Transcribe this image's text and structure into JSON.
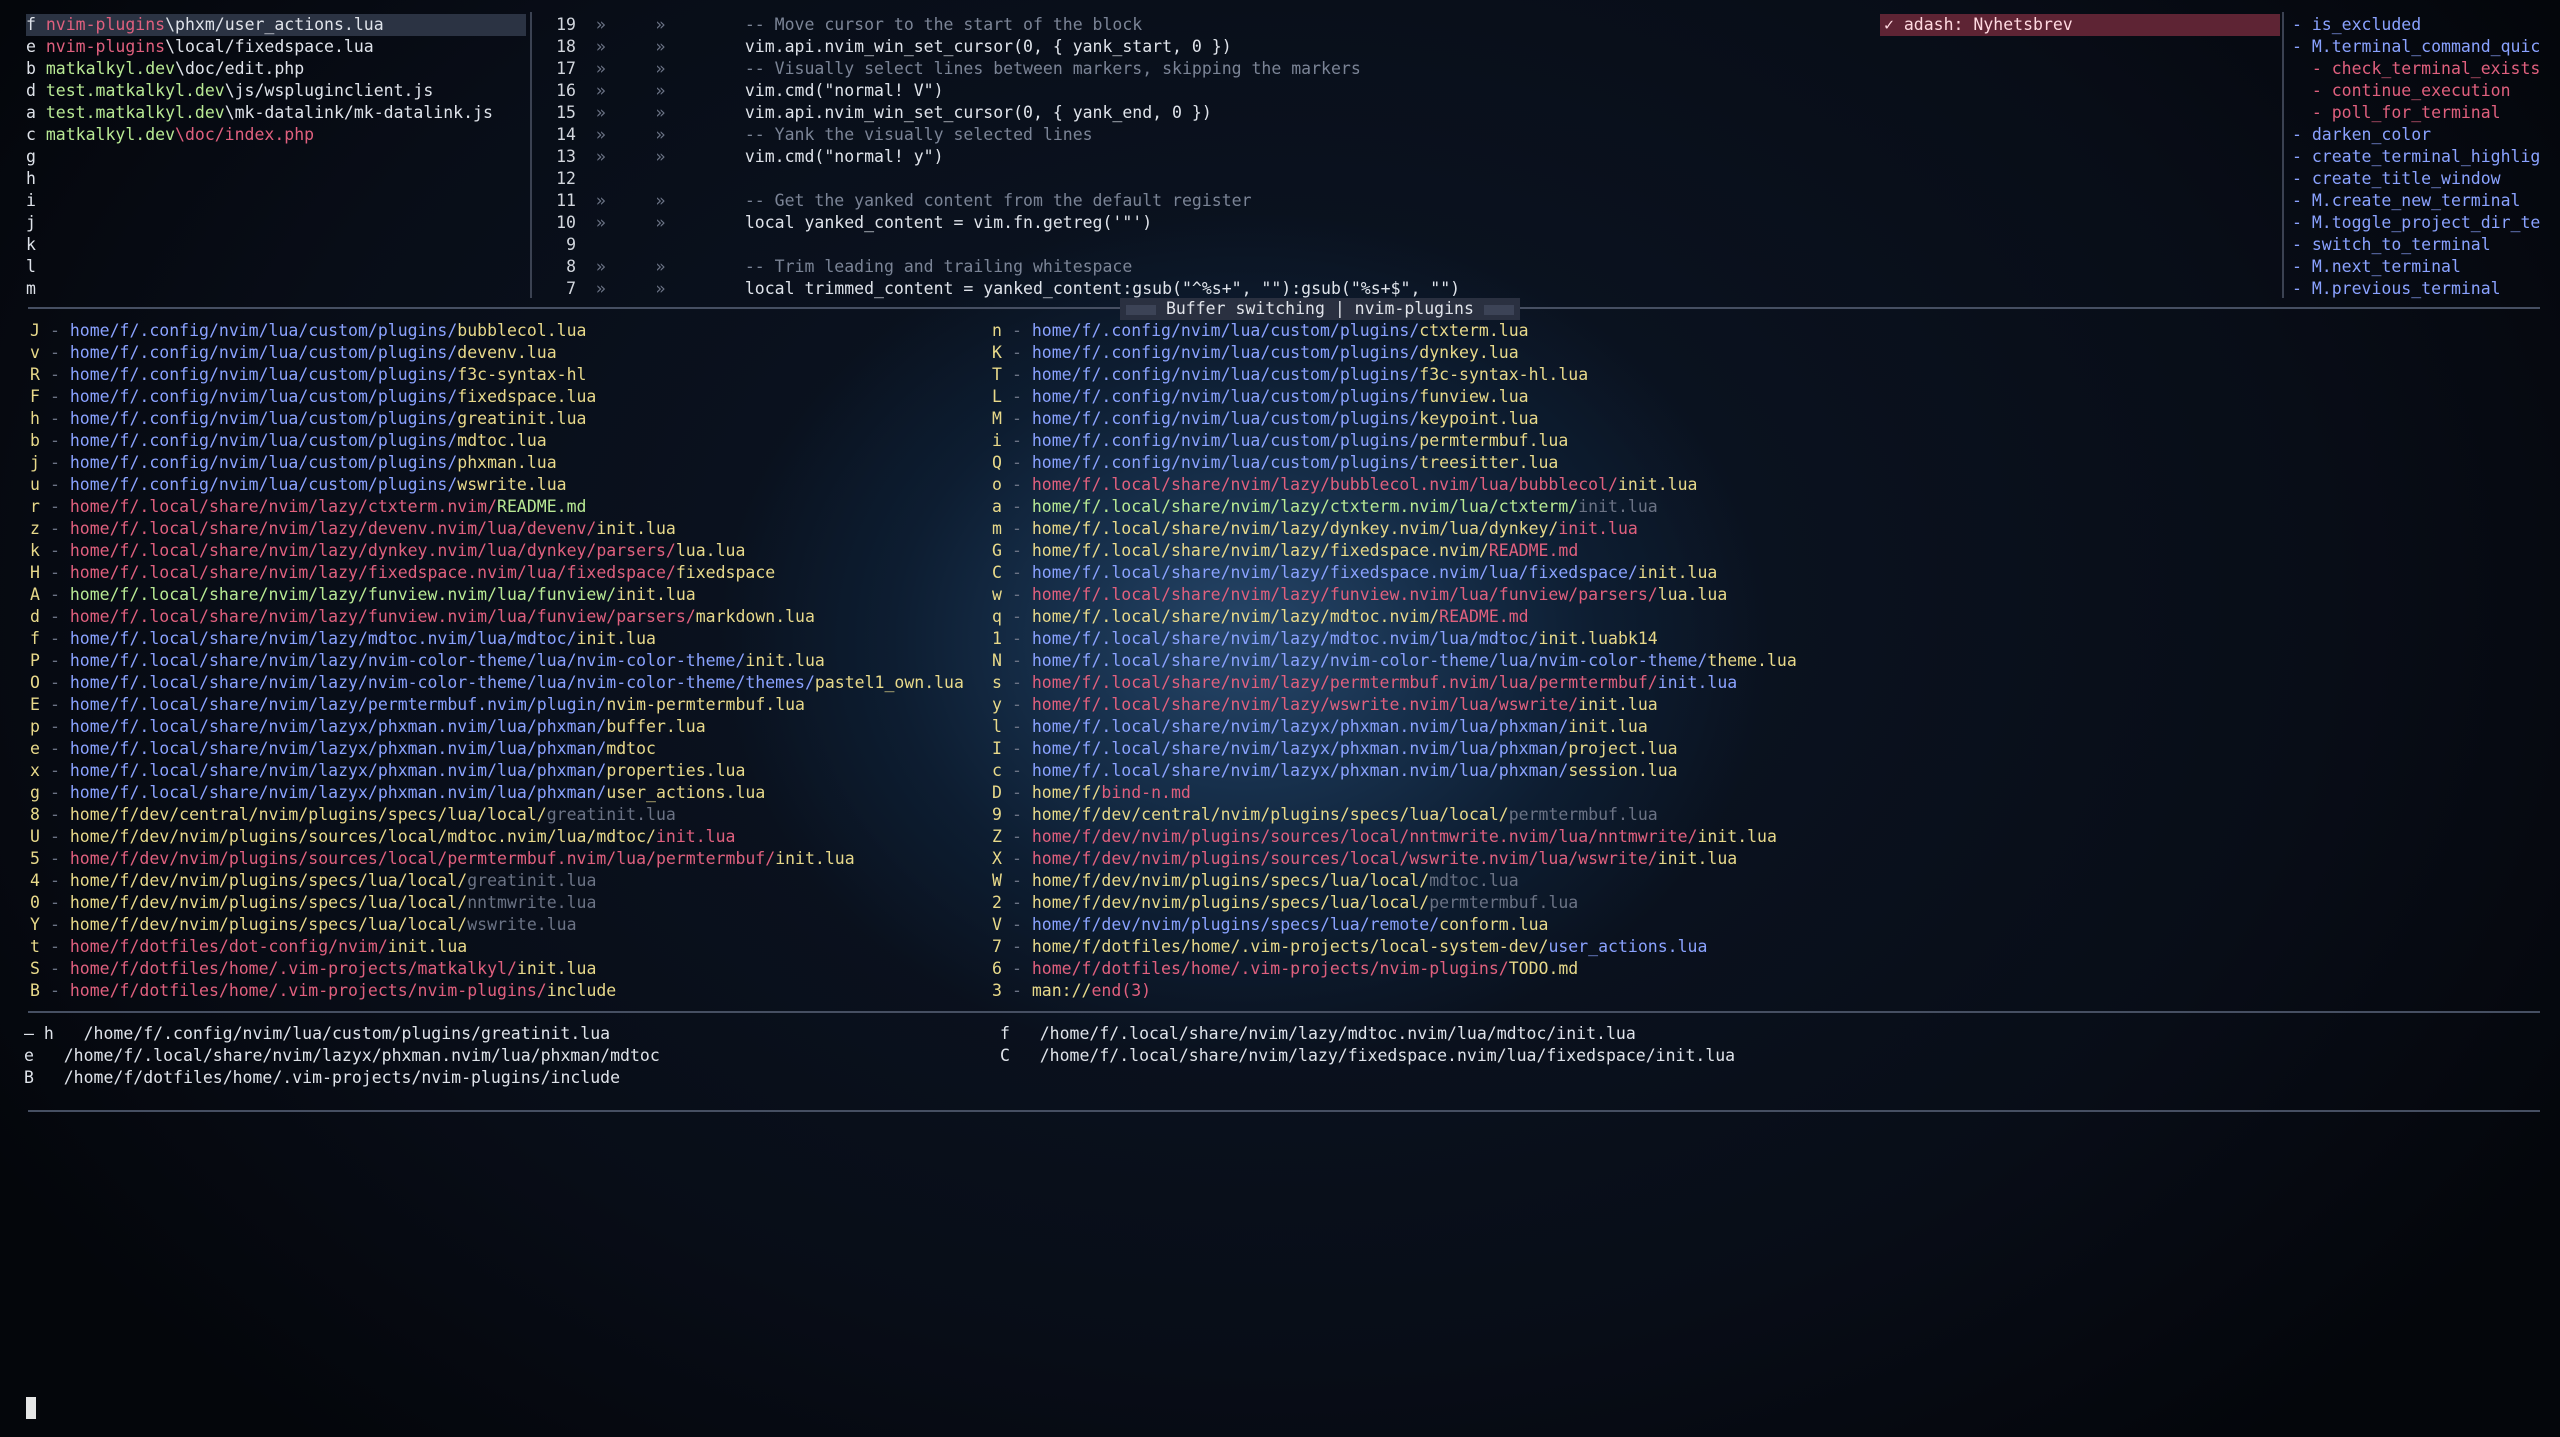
{
  "quick_list": [
    {
      "key": "f",
      "parts": [
        {
          "t": "nvim-plugins",
          "c": "red"
        },
        {
          "t": "\\phxm/user_actions.lua",
          "c": "white"
        }
      ],
      "selected": true
    },
    {
      "key": "e",
      "parts": [
        {
          "t": "nvim-plugins",
          "c": "red"
        },
        {
          "t": "\\local/fixedspace.lua",
          "c": "white"
        }
      ]
    },
    {
      "key": "b",
      "parts": [
        {
          "t": "matkalkyl.dev",
          "c": "green"
        },
        {
          "t": "\\doc/edit.php",
          "c": "white"
        }
      ]
    },
    {
      "key": "d",
      "parts": [
        {
          "t": "test.matkalkyl.dev",
          "c": "green"
        },
        {
          "t": "\\js/wspluginclient.js",
          "c": "white"
        }
      ]
    },
    {
      "key": "a",
      "parts": [
        {
          "t": "test.matkalkyl.dev",
          "c": "green"
        },
        {
          "t": "\\mk-datalink/mk-datalink.js",
          "c": "white"
        }
      ]
    },
    {
      "key": "c",
      "parts": [
        {
          "t": "matkalkyl.dev",
          "c": "green"
        },
        {
          "t": "\\doc/index.php",
          "c": "red"
        }
      ]
    },
    {
      "key": "g",
      "parts": []
    },
    {
      "key": "h",
      "parts": []
    },
    {
      "key": "i",
      "parts": []
    },
    {
      "key": "j",
      "parts": []
    },
    {
      "key": "k",
      "parts": []
    },
    {
      "key": "l",
      "parts": []
    },
    {
      "key": "m",
      "parts": []
    }
  ],
  "code_lines": [
    {
      "n": "19",
      "a": "»     »",
      "t": "  -- Move cursor to the start of the block",
      "c": "comment"
    },
    {
      "n": "18",
      "a": "»     »",
      "t": "  vim.api.nvim_win_set_cursor(0, { yank_start, 0 })",
      "c": "white"
    },
    {
      "n": "17",
      "a": "»     »",
      "t": "  -- Visually select lines between markers, skipping the markers",
      "c": "comment"
    },
    {
      "n": "16",
      "a": "»     »",
      "t": "  vim.cmd(\"normal! V\")",
      "c": "white"
    },
    {
      "n": "15",
      "a": "»     »",
      "t": "  vim.api.nvim_win_set_cursor(0, { yank_end, 0 })",
      "c": "white"
    },
    {
      "n": "14",
      "a": "»     »",
      "t": "  -- Yank the visually selected lines",
      "c": "comment"
    },
    {
      "n": "13",
      "a": "»     »",
      "t": "  vim.cmd(\"normal! y\")",
      "c": "white"
    },
    {
      "n": "12",
      "a": "",
      "t": "",
      "c": "white"
    },
    {
      "n": "11",
      "a": "»     »",
      "t": "  -- Get the yanked content from the default register",
      "c": "comment"
    },
    {
      "n": "10",
      "a": "»     »",
      "t": "  local yanked_content = vim.fn.getreg('\"')",
      "c": "white"
    },
    {
      "n": "9",
      "a": "",
      "t": "",
      "c": "white"
    },
    {
      "n": "8",
      "a": "»     »",
      "t": "  -- Trim leading and trailing whitespace",
      "c": "comment"
    },
    {
      "n": "7",
      "a": "»     »",
      "t": "  local trimmed_content = yanked_content:gsub(\"^%s+\", \"\"):gsub(\"%s+$\", \"\")",
      "c": "white"
    }
  ],
  "notification": "✓ adash: Nyhetsbrev",
  "outline": [
    {
      "t": "- is_excluded",
      "c": "blue"
    },
    {
      "t": "- M.terminal_command_quic",
      "c": "blue"
    },
    {
      "t": "  - check_terminal_exists",
      "c": "red"
    },
    {
      "t": "  - continue_execution",
      "c": "red"
    },
    {
      "t": "  - poll_for_terminal",
      "c": "red"
    },
    {
      "t": "- darken_color",
      "c": "blue"
    },
    {
      "t": "- create_terminal_highlig",
      "c": "blue"
    },
    {
      "t": "- create_title_window",
      "c": "blue"
    },
    {
      "t": "- M.create_new_terminal",
      "c": "blue"
    },
    {
      "t": "- M.toggle_project_dir_te",
      "c": "blue"
    },
    {
      "t": "- switch_to_terminal",
      "c": "blue"
    },
    {
      "t": "- M.next_terminal",
      "c": "blue"
    },
    {
      "t": "- M.previous_terminal",
      "c": "blue"
    }
  ],
  "buffer_title": "Buffer switching | nvim-plugins",
  "buffers_left": [
    {
      "k": "J",
      "p": "home/f/.config/nvim/lua/custom/plugins/",
      "f": "bubblecol.lua",
      "fc": "yellow"
    },
    {
      "k": "v",
      "p": "home/f/.config/nvim/lua/custom/plugins/",
      "f": "devenv.lua",
      "fc": "yellow"
    },
    {
      "k": "R",
      "p": "home/f/.config/nvim/lua/custom/plugins/",
      "f": "f3c-syntax-hl",
      "fc": "yellow"
    },
    {
      "k": "F",
      "p": "home/f/.config/nvim/lua/custom/plugins/",
      "f": "fixedspace.lua",
      "fc": "yellow"
    },
    {
      "k": "h",
      "p": "home/f/.config/nvim/lua/custom/plugins/",
      "f": "greatinit.lua",
      "fc": "yellow"
    },
    {
      "k": "b",
      "p": "home/f/.config/nvim/lua/custom/plugins/",
      "f": "mdtoc.lua",
      "fc": "yellow"
    },
    {
      "k": "j",
      "p": "home/f/.config/nvim/lua/custom/plugins/",
      "f": "phxman.lua",
      "fc": "yellow"
    },
    {
      "k": "u",
      "p": "home/f/.config/nvim/lua/custom/plugins/",
      "f": "wswrite.lua",
      "fc": "yellow"
    },
    {
      "k": "r",
      "p": "home/f/.local/share/nvim/lazy/ctxterm.nvim/",
      "f": "README.md",
      "fc": "green",
      "pc": "red"
    },
    {
      "k": "z",
      "p": "home/f/.local/share/nvim/lazy/devenv.nvim/lua/devenv/",
      "f": "init.lua",
      "fc": "yellow",
      "pc": "red"
    },
    {
      "k": "k",
      "p": "home/f/.local/share/nvim/lazy/dynkey.nvim/lua/dynkey/parsers/",
      "f": "lua.lua",
      "fc": "yellow",
      "pc": "red"
    },
    {
      "k": "H",
      "p": "home/f/.local/share/nvim/lazy/fixedspace.nvim/lua/fixedspace/",
      "f": "fixedspace",
      "fc": "yellow",
      "pc": "red"
    },
    {
      "k": "A",
      "p": "home/f/.local/share/nvim/lazy/funview.nvim/lua/funview/",
      "f": "init.lua",
      "fc": "yellow",
      "pc": "green"
    },
    {
      "k": "d",
      "p": "home/f/.local/share/nvim/lazy/funview.nvim/lua/funview/parsers/",
      "f": "markdown.lua",
      "fc": "yellow",
      "pc": "red"
    },
    {
      "k": "f",
      "p": "home/f/.local/share/nvim/lazy/mdtoc.nvim/lua/mdtoc/",
      "f": "init.lua",
      "fc": "yellow"
    },
    {
      "k": "P",
      "p": "home/f/.local/share/nvim/lazy/nvim-color-theme/lua/nvim-color-theme/",
      "f": "init.lua",
      "fc": "yellow"
    },
    {
      "k": "O",
      "p": "home/f/.local/share/nvim/lazy/nvim-color-theme/lua/nvim-color-theme/themes/",
      "f": "pastel1_own.lua",
      "fc": "yellow"
    },
    {
      "k": "E",
      "p": "home/f/.local/share/nvim/lazy/permtermbuf.nvim/plugin/",
      "f": "nvim-permtermbuf.lua",
      "fc": "yellow"
    },
    {
      "k": "p",
      "p": "home/f/.local/share/nvim/lazyx/phxman.nvim/lua/phxman/",
      "f": "buffer.lua",
      "fc": "yellow"
    },
    {
      "k": "e",
      "p": "home/f/.local/share/nvim/lazyx/phxman.nvim/lua/phxman/",
      "f": "mdtoc",
      "fc": "yellow"
    },
    {
      "k": "x",
      "p": "home/f/.local/share/nvim/lazyx/phxman.nvim/lua/phxman/",
      "f": "properties.lua",
      "fc": "yellow"
    },
    {
      "k": "g",
      "p": "home/f/.local/share/nvim/lazyx/phxman.nvim/lua/phxman/",
      "f": "user_actions.lua",
      "fc": "yellow"
    },
    {
      "k": "8",
      "p": "home/f/dev/central/nvim/plugins/specs/lua/local/",
      "f": "greatinit.lua",
      "fc": "muted",
      "pc": "yellow"
    },
    {
      "k": "U",
      "p": "home/f/dev/nvim/plugins/sources/local/mdtoc.nvim/lua/mdtoc/",
      "f": "init.lua",
      "fc": "red",
      "pc": "yellow"
    },
    {
      "k": "5",
      "p": "home/f/dev/nvim/plugins/sources/local/permtermbuf.nvim/lua/permtermbuf/",
      "f": "init.lua",
      "fc": "yellow",
      "pc": "red"
    },
    {
      "k": "4",
      "p": "home/f/dev/nvim/plugins/specs/lua/local/",
      "f": "greatinit.lua",
      "fc": "muted",
      "pc": "yellow"
    },
    {
      "k": "0",
      "p": "home/f/dev/nvim/plugins/specs/lua/local/",
      "f": "nntmwrite.lua",
      "fc": "muted",
      "pc": "yellow"
    },
    {
      "k": "Y",
      "p": "home/f/dev/nvim/plugins/specs/lua/local/",
      "f": "wswrite.lua",
      "fc": "muted",
      "pc": "yellow"
    },
    {
      "k": "t",
      "p": "home/f/dotfiles/dot-config/nvim/",
      "f": "init.lua",
      "fc": "yellow",
      "pc": "red"
    },
    {
      "k": "S",
      "p": "home/f/dotfiles/home/.vim-projects/matkalkyl/",
      "f": "init.lua",
      "fc": "yellow",
      "pc": "red"
    },
    {
      "k": "B",
      "p": "home/f/dotfiles/home/.vim-projects/nvim-plugins/",
      "f": "include",
      "fc": "yellow",
      "pc": "red"
    }
  ],
  "buffers_right": [
    {
      "k": "n",
      "p": "home/f/.config/nvim/lua/custom/plugins/",
      "f": "ctxterm.lua",
      "fc": "yellow"
    },
    {
      "k": "K",
      "p": "home/f/.config/nvim/lua/custom/plugins/",
      "f": "dynkey.lua",
      "fc": "yellow"
    },
    {
      "k": "T",
      "p": "home/f/.config/nvim/lua/custom/plugins/",
      "f": "f3c-syntax-hl.lua",
      "fc": "yellow"
    },
    {
      "k": "L",
      "p": "home/f/.config/nvim/lua/custom/plugins/",
      "f": "funview.lua",
      "fc": "yellow"
    },
    {
      "k": "M",
      "p": "home/f/.config/nvim/lua/custom/plugins/",
      "f": "keypoint.lua",
      "fc": "yellow"
    },
    {
      "k": "i",
      "p": "home/f/.config/nvim/lua/custom/plugins/",
      "f": "permtermbuf.lua",
      "fc": "yellow"
    },
    {
      "k": "Q",
      "p": "home/f/.config/nvim/lua/custom/plugins/",
      "f": "treesitter.lua",
      "fc": "yellow"
    },
    {
      "k": "o",
      "p": "home/f/.local/share/nvim/lazy/bubblecol.nvim/lua/bubblecol/",
      "f": "init.lua",
      "fc": "yellow",
      "pc": "red"
    },
    {
      "k": "a",
      "p": "home/f/.local/share/nvim/lazy/ctxterm.nvim/lua/ctxterm/",
      "f": "init.lua",
      "fc": "muted",
      "pc": "green"
    },
    {
      "k": "m",
      "p": "home/f/.local/share/nvim/lazy/dynkey.nvim/lua/dynkey/",
      "f": "init.lua",
      "fc": "red",
      "pc": "yellow"
    },
    {
      "k": "G",
      "p": "home/f/.local/share/nvim/lazy/fixedspace.nvim/",
      "f": "README.md",
      "fc": "red",
      "pc": "yellow"
    },
    {
      "k": "C",
      "p": "home/f/.local/share/nvim/lazy/fixedspace.nvim/lua/fixedspace/",
      "f": "init.lua",
      "fc": "yellow"
    },
    {
      "k": "w",
      "p": "home/f/.local/share/nvim/lazy/funview.nvim/lua/funview/parsers/",
      "f": "lua.lua",
      "fc": "yellow",
      "pc": "red"
    },
    {
      "k": "q",
      "p": "home/f/.local/share/nvim/lazy/mdtoc.nvim/",
      "f": "README.md",
      "fc": "red",
      "pc": "yellow"
    },
    {
      "k": "1",
      "p": "home/f/.local/share/nvim/lazy/mdtoc.nvim/lua/mdtoc/",
      "f": "init.luabk14",
      "fc": "yellow"
    },
    {
      "k": "N",
      "p": "home/f/.local/share/nvim/lazy/nvim-color-theme/lua/nvim-color-theme/",
      "f": "theme.lua",
      "fc": "yellow"
    },
    {
      "k": "s",
      "p": "home/f/.local/share/nvim/lazy/permtermbuf.nvim/lua/permtermbuf/",
      "f": "init.lua",
      "fc": "blue",
      "pc": "red"
    },
    {
      "k": "y",
      "p": "home/f/.local/share/nvim/lazy/wswrite.nvim/lua/wswrite/",
      "f": "init.lua",
      "fc": "yellow",
      "pc": "red"
    },
    {
      "k": "l",
      "p": "home/f/.local/share/nvim/lazyx/phxman.nvim/lua/phxman/",
      "f": "init.lua",
      "fc": "yellow"
    },
    {
      "k": "I",
      "p": "home/f/.local/share/nvim/lazyx/phxman.nvim/lua/phxman/",
      "f": "project.lua",
      "fc": "yellow"
    },
    {
      "k": "c",
      "p": "home/f/.local/share/nvim/lazyx/phxman.nvim/lua/phxman/",
      "f": "session.lua",
      "fc": "yellow"
    },
    {
      "k": "D",
      "p": "home/f/",
      "f": "bind-n.md",
      "fc": "red",
      "pc": "yellow"
    },
    {
      "k": "9",
      "p": "home/f/dev/central/nvim/plugins/specs/lua/local/",
      "f": "permtermbuf.lua",
      "fc": "muted",
      "pc": "yellow"
    },
    {
      "k": "Z",
      "p": "home/f/dev/nvim/plugins/sources/local/nntmwrite.nvim/lua/nntmwrite/",
      "f": "init.lua",
      "fc": "yellow",
      "pc": "red"
    },
    {
      "k": "X",
      "p": "home/f/dev/nvim/plugins/sources/local/wswrite.nvim/lua/wswrite/",
      "f": "init.lua",
      "fc": "yellow",
      "pc": "red"
    },
    {
      "k": "W",
      "p": "home/f/dev/nvim/plugins/specs/lua/local/",
      "f": "mdtoc.lua",
      "fc": "muted",
      "pc": "yellow"
    },
    {
      "k": "2",
      "p": "home/f/dev/nvim/plugins/specs/lua/local/",
      "f": "permtermbuf.lua",
      "fc": "muted",
      "pc": "yellow"
    },
    {
      "k": "V",
      "p": "home/f/dev/nvim/plugins/specs/lua/remote/",
      "f": "conform.lua",
      "fc": "yellow",
      "pc": "blue"
    },
    {
      "k": "7",
      "p": "home/f/dotfiles/home/.vim-projects/local-system-dev/",
      "f": "user_actions.lua",
      "fc": "blue",
      "pc": "yellow"
    },
    {
      "k": "6",
      "p": "home/f/dotfiles/home/.vim-projects/nvim-plugins/",
      "f": "TODO.md",
      "fc": "yellow",
      "pc": "red"
    },
    {
      "k": "3",
      "p": "man://",
      "f": "end(3)",
      "fc": "red",
      "pc": "yellow"
    }
  ],
  "marks": [
    [
      {
        "k": "— h",
        "p": "/home/f/.config/nvim/lua/custom/plugins/greatinit.lua"
      },
      {
        "k": "f",
        "p": "/home/f/.local/share/nvim/lazy/mdtoc.nvim/lua/mdtoc/init.lua"
      }
    ],
    [
      {
        "k": "e",
        "p": "/home/f/.local/share/nvim/lazyx/phxman.nvim/lua/phxman/mdtoc"
      },
      {
        "k": "C",
        "p": "/home/f/.local/share/nvim/lazy/fixedspace.nvim/lua/fixedspace/init.lua"
      }
    ],
    [
      {
        "k": "B",
        "p": "/home/f/dotfiles/home/.vim-projects/nvim-plugins/include"
      }
    ]
  ]
}
